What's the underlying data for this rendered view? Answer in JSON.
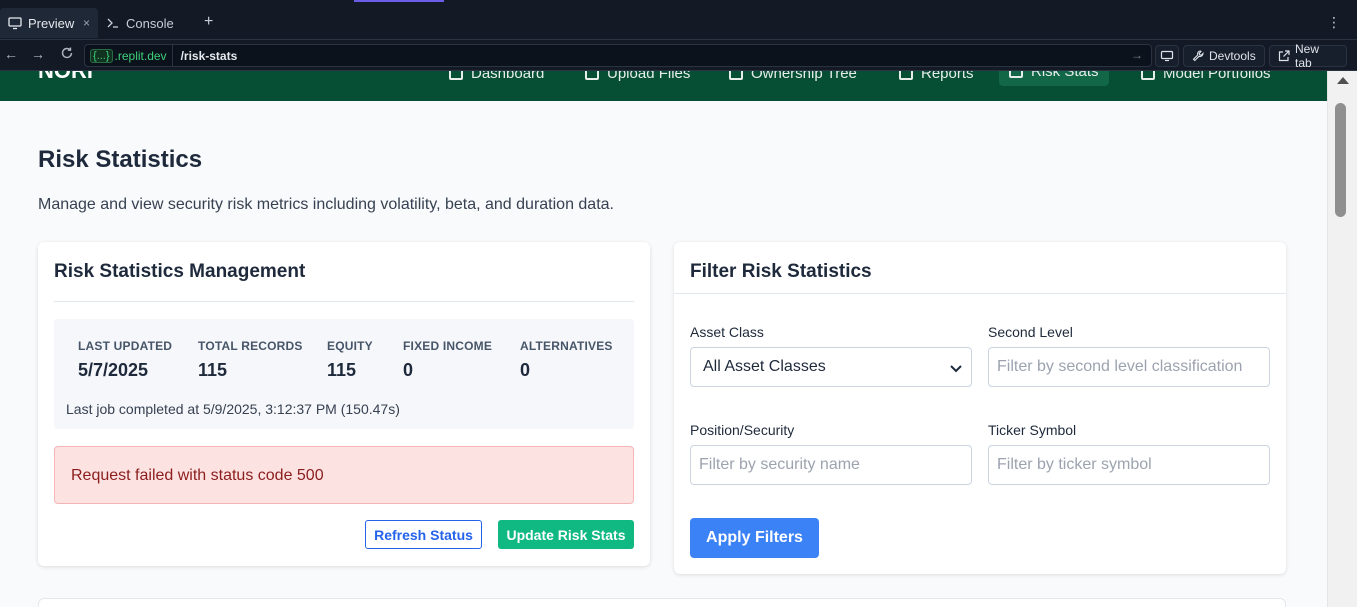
{
  "browser": {
    "tabs": [
      {
        "label": "Preview",
        "icon": "monitor-icon",
        "close": "×"
      },
      {
        "label": "Console",
        "icon": "terminal-icon"
      }
    ],
    "add_tab": "+",
    "menu": "⋮",
    "url_host_braces": "{...}",
    "url_host": ".replit.dev",
    "url_path": "/risk-stats",
    "devtools_label": "Devtools",
    "new_tab_label": "New tab"
  },
  "header": {
    "brand": "NORI",
    "nav": [
      {
        "label": "Dashboard",
        "icon": "dashboard-icon"
      },
      {
        "label": "Upload Files",
        "icon": "upload-icon"
      },
      {
        "label": "Ownership Tree",
        "icon": "tree-icon"
      },
      {
        "label": "Reports",
        "icon": "report-icon"
      },
      {
        "label": "Risk Stats",
        "icon": "chart-icon",
        "active": true
      },
      {
        "label": "Model Portfolios",
        "icon": "portfolio-icon"
      }
    ],
    "color": "#064e34"
  },
  "page": {
    "title": "Risk Statistics",
    "description": "Manage and view security risk metrics including volatility, beta, and duration data."
  },
  "management": {
    "title": "Risk Statistics Management",
    "stats": [
      {
        "label": "LAST UPDATED",
        "value": "5/7/2025"
      },
      {
        "label": "TOTAL RECORDS",
        "value": "115"
      },
      {
        "label": "EQUITY",
        "value": "115"
      },
      {
        "label": "FIXED INCOME",
        "value": "0"
      },
      {
        "label": "ALTERNATIVES",
        "value": "0"
      }
    ],
    "job_status": "Last job completed at 5/9/2025, 3:12:37 PM (150.47s)",
    "error": "Request failed with status code 500",
    "refresh_label": "Refresh Status",
    "update_label": "Update Risk Stats"
  },
  "filters": {
    "title": "Filter Risk Statistics",
    "asset_class": {
      "label": "Asset Class",
      "value": "All Asset Classes"
    },
    "second_level": {
      "label": "Second Level",
      "placeholder": "Filter by second level classification"
    },
    "position": {
      "label": "Position/Security",
      "placeholder": "Filter by security name"
    },
    "ticker": {
      "label": "Ticker Symbol",
      "placeholder": "Filter by ticker symbol"
    },
    "apply_label": "Apply Filters"
  },
  "colors": {
    "accent_blue": "#3b82f6",
    "accent_green": "#10b981",
    "error_bg": "#fde2e2"
  }
}
